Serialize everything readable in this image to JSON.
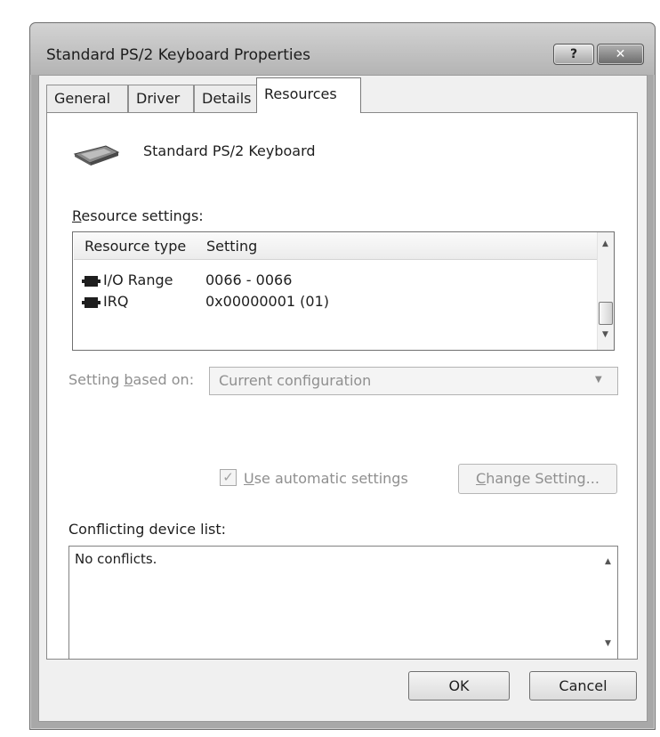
{
  "window": {
    "title": "Standard PS/2 Keyboard Properties",
    "help_glyph": "?",
    "close_glyph": "✕"
  },
  "tabs": [
    {
      "label": "General",
      "selected": false
    },
    {
      "label": "Driver",
      "selected": false
    },
    {
      "label": "Details",
      "selected": false
    },
    {
      "label": "Resources",
      "selected": true
    }
  ],
  "device": {
    "name": "Standard PS/2 Keyboard",
    "icon": "keyboard-icon"
  },
  "resource_settings": {
    "label_accel": "R",
    "label_rest": "esource settings:",
    "columns": [
      "Resource type",
      "Setting"
    ],
    "rows": [
      {
        "type": "I/O Range",
        "setting": "0066 - 0066",
        "icon": "chip-icon"
      },
      {
        "type": "IRQ",
        "setting": "0x00000001 (01)",
        "icon": "chip-icon"
      }
    ]
  },
  "setting_based_on": {
    "label_pre": "Setting ",
    "label_accel": "b",
    "label_post": "ased on:",
    "value": "Current configuration",
    "enabled": false
  },
  "automatic": {
    "checked": true,
    "enabled": false,
    "label_accel": "U",
    "label_rest": "se automatic settings",
    "check_glyph": "✓"
  },
  "change_setting": {
    "label_accel": "C",
    "label_rest": "hange Setting...",
    "enabled": false
  },
  "conflicts": {
    "label": "Conflicting device list:",
    "text": "No conflicts."
  },
  "buttons": {
    "ok": "OK",
    "cancel": "Cancel"
  },
  "colors": {
    "dialog_bg": "#f0f0f0",
    "panel_bg": "#ffffff",
    "disabled_text": "#8f8f8f"
  }
}
